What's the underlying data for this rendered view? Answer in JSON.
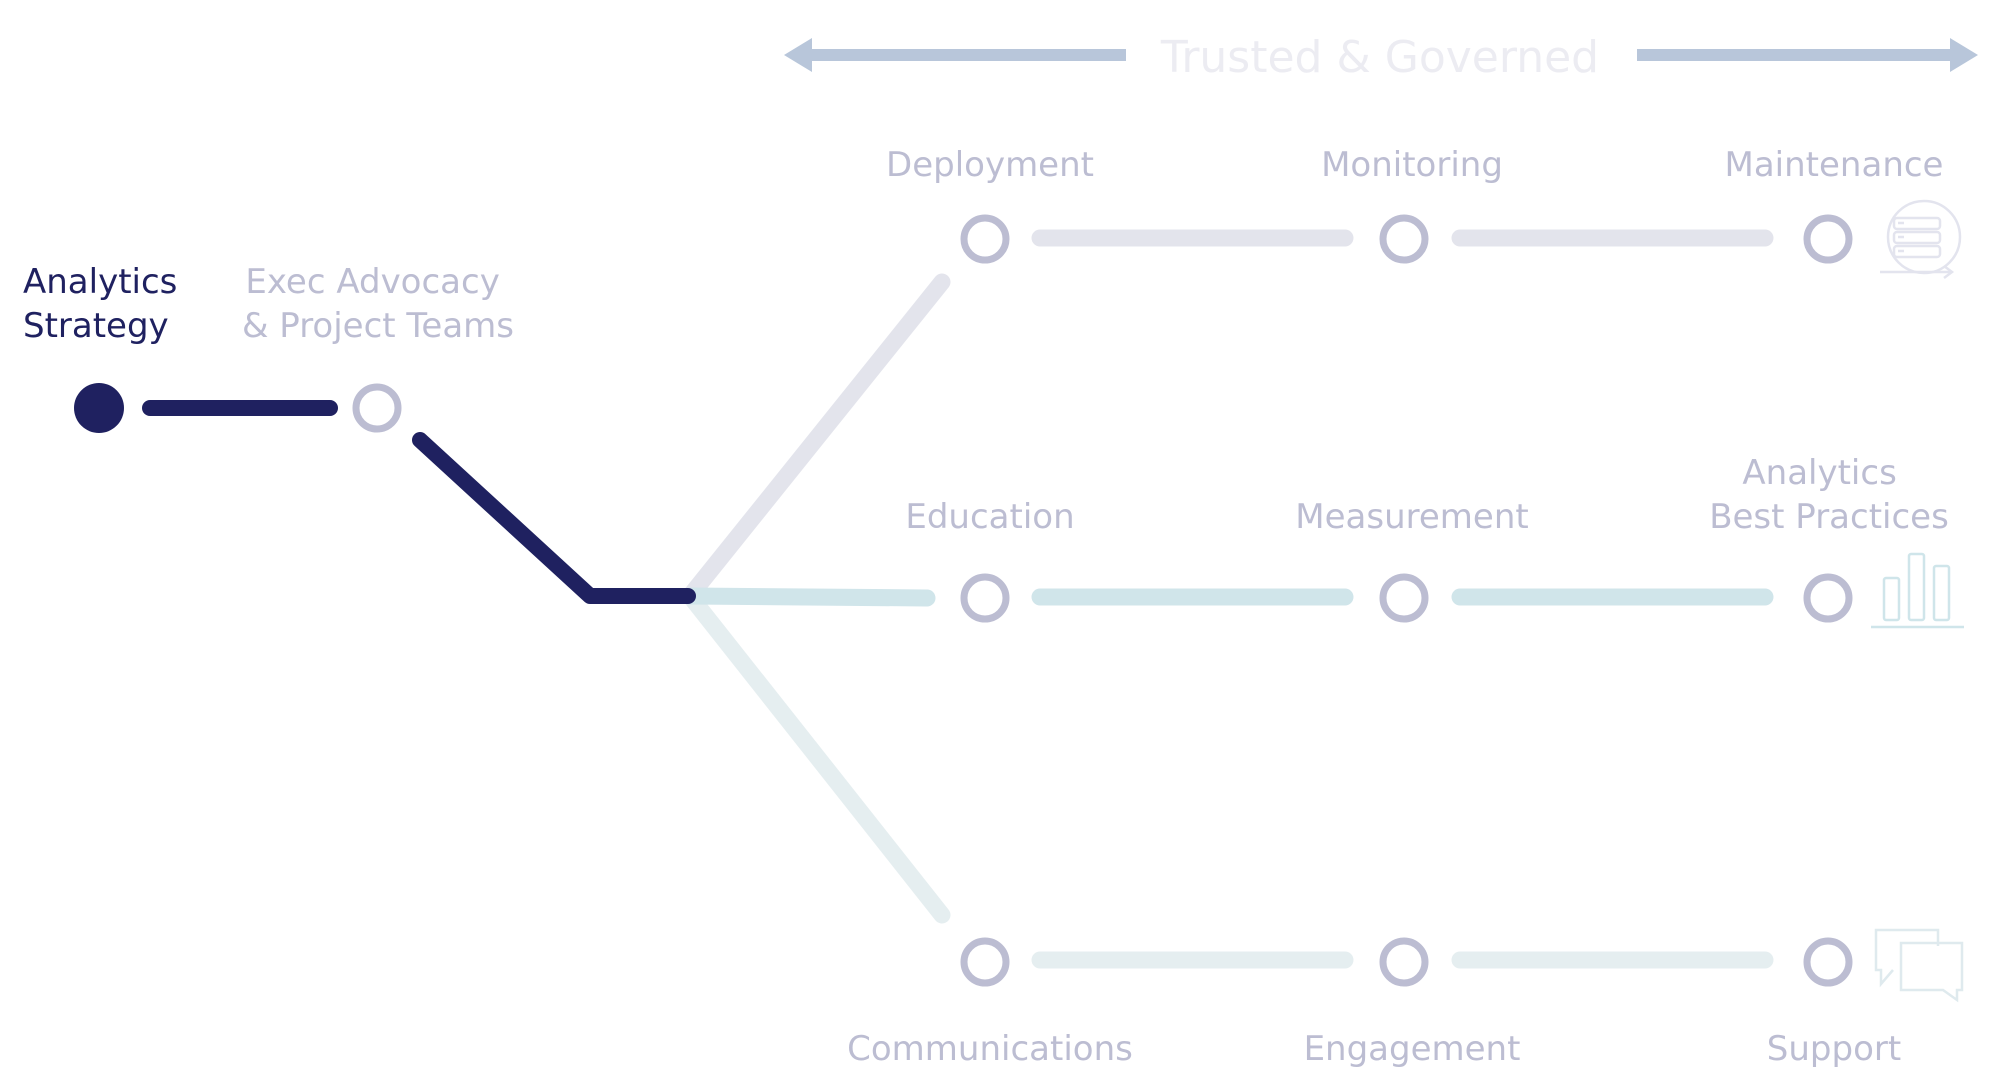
{
  "header": {
    "title": "Trusted & Governed",
    "left_arrow_icon": "arrow-left-icon",
    "right_arrow_icon": "arrow-right-icon"
  },
  "colors": {
    "active": "#1f2160",
    "inactive_text": "#bcbdd2",
    "node_ring": "#bcbdd2",
    "title_text": "#ececf2",
    "arrow": "#b8c6da",
    "track_top": "#e0e1ea",
    "track_middle": "#d0e5ea",
    "track_bottom": "#e2ecee",
    "icon_top": "#e3e4ee",
    "icon_middle": "#cfe5ea",
    "icon_bottom": "#dfeaee"
  },
  "start": {
    "nodes": [
      {
        "label_lines": [
          "Analytics",
          "Strategy"
        ],
        "state": "active"
      },
      {
        "label_lines": [
          "Exec Advocacy",
          "& Project Teams"
        ],
        "state": "inactive"
      }
    ]
  },
  "branches": [
    {
      "name": "top",
      "nodes": [
        {
          "label_lines": [
            "Deployment"
          ]
        },
        {
          "label_lines": [
            "Monitoring"
          ]
        },
        {
          "label_lines": [
            "Maintenance"
          ]
        }
      ],
      "icon": "server-maintenance-icon"
    },
    {
      "name": "middle",
      "nodes": [
        {
          "label_lines": [
            "Education"
          ]
        },
        {
          "label_lines": [
            "Measurement"
          ]
        },
        {
          "label_lines": [
            "Analytics",
            "Best Practices"
          ]
        }
      ],
      "icon": "bar-chart-icon"
    },
    {
      "name": "bottom",
      "nodes": [
        {
          "label_lines": [
            "Communications"
          ]
        },
        {
          "label_lines": [
            "Engagement"
          ]
        },
        {
          "label_lines": [
            "Support"
          ]
        }
      ],
      "icon": "chat-bubbles-icon"
    }
  ]
}
